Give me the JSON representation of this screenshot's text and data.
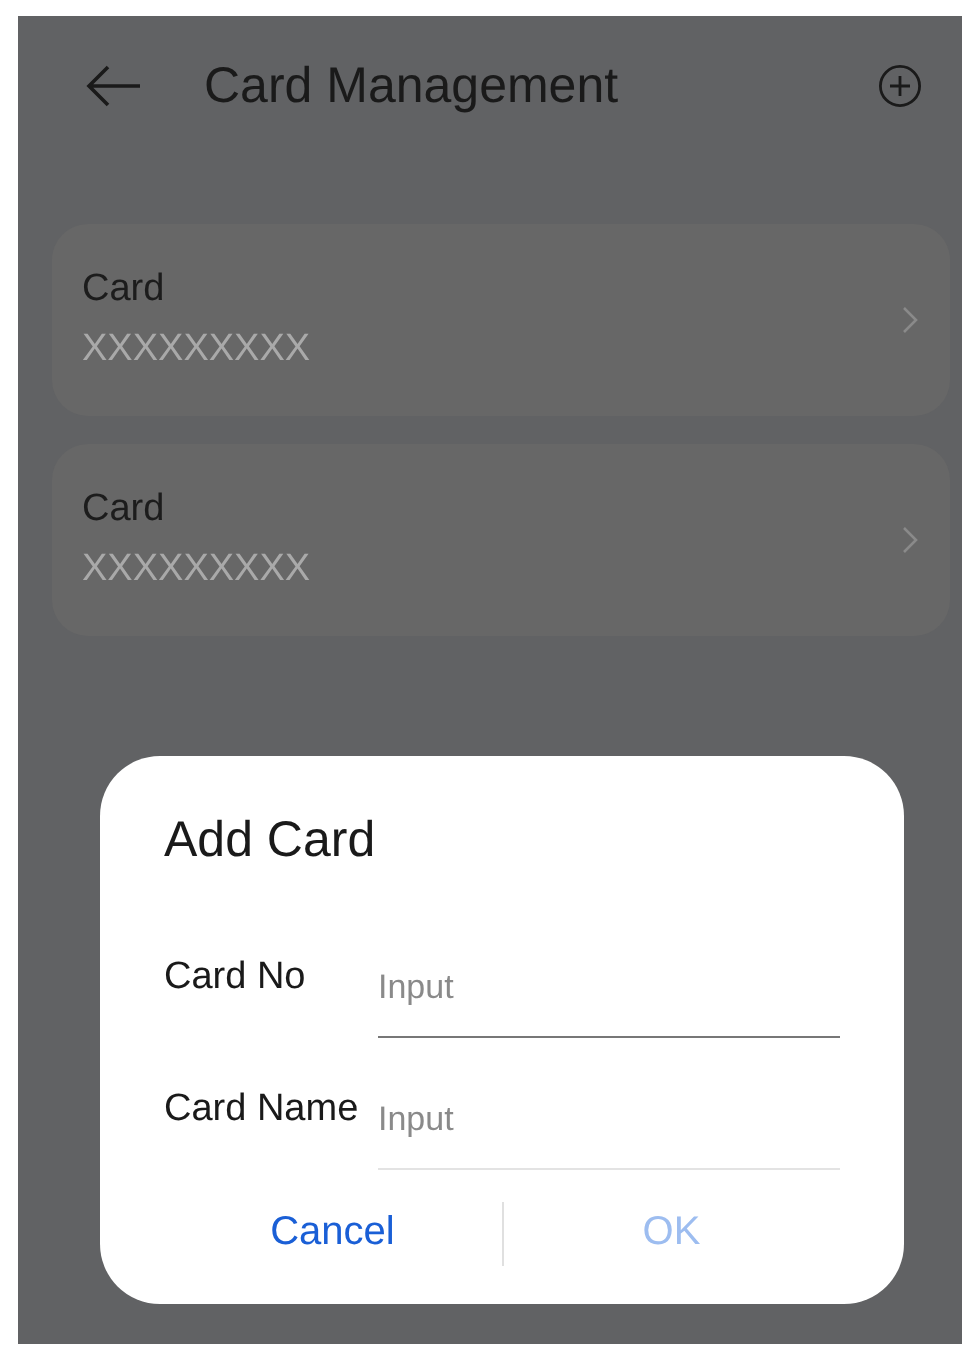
{
  "header": {
    "title": "Card Management"
  },
  "cards": [
    {
      "name": "Card",
      "number": "XXXXXXXXX"
    },
    {
      "name": "Card",
      "number": "XXXXXXXXX"
    }
  ],
  "dialog": {
    "title": "Add Card",
    "fields": [
      {
        "label": "Card No",
        "placeholder": "Input",
        "focused": true
      },
      {
        "label": "Card Name",
        "placeholder": "Input",
        "focused": false
      }
    ],
    "buttons": [
      {
        "label": "Cancel",
        "disabled": false
      },
      {
        "label": "OK",
        "disabled": true
      }
    ]
  }
}
